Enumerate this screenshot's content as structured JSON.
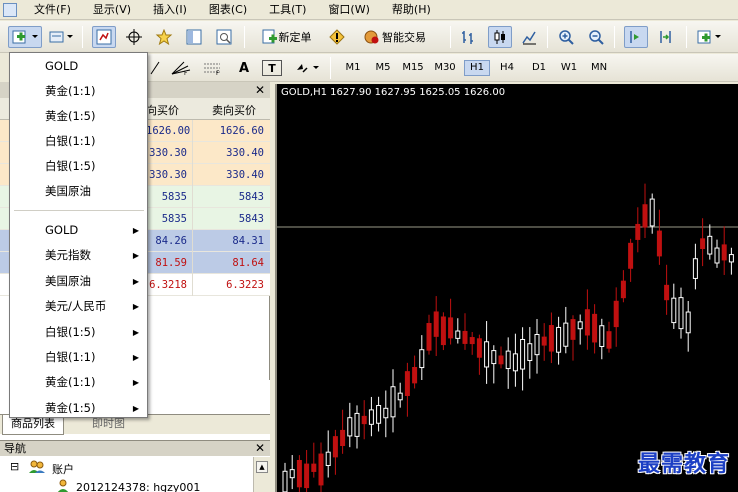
{
  "menu": [
    "文件(F)",
    "显示(V)",
    "插入(I)",
    "图表(C)",
    "工具(T)",
    "窗口(W)",
    "帮助(H)"
  ],
  "toolbar": {
    "new_order_label": "新定单",
    "expert_label": "智能交易"
  },
  "timeframes": [
    "M1",
    "M5",
    "M15",
    "M30",
    "H1",
    "H4",
    "D1",
    "W1",
    "MN"
  ],
  "active_timeframe": "H1",
  "drawing_tools": {
    "text_tool": "A",
    "text_label_tool": "T"
  },
  "market_watch": {
    "column_bid": "向买价",
    "column_ask": "卖向买价",
    "rows": [
      {
        "bid": "1626.00",
        "ask": "1626.60",
        "bg": "#fce8c8",
        "color": "#1a2a8a"
      },
      {
        "bid": "330.30",
        "ask": "330.40",
        "bg": "#fce8c8",
        "color": "#1a2a8a"
      },
      {
        "bid": "330.30",
        "ask": "330.40",
        "bg": "#fce8c8",
        "color": "#1a2a8a"
      },
      {
        "bid": "5835",
        "ask": "5843",
        "bg": "#e8f5e4",
        "color": "#1a2a8a"
      },
      {
        "bid": "5835",
        "ask": "5843",
        "bg": "#e8f5e4",
        "color": "#1a2a8a"
      },
      {
        "bid": "84.26",
        "ask": "84.31",
        "bg": "#bccbe6",
        "color": "#1a2a8a"
      },
      {
        "bid": "81.59",
        "ask": "81.64",
        "bg": "#bccbe6",
        "color": "#c01010"
      },
      {
        "bid": "6.3218",
        "ask": "6.3223",
        "bg": "#ffffff",
        "color": "#c01010"
      }
    ]
  },
  "tabs": [
    "商品列表",
    "即时图"
  ],
  "dropdown": {
    "items_top": [
      "GOLD",
      "黄金(1:1)",
      "黄金(1:5)",
      "白银(1:1)",
      "白银(1:5)",
      "美国原油"
    ],
    "items_sub": [
      "GOLD",
      "美元指数",
      "美国原油",
      "美元/人民币",
      "白银(1:5)",
      "白银(1:1)",
      "黄金(1:1)",
      "黄金(1:5)"
    ]
  },
  "navigator": {
    "title": "导航",
    "account_label": "账户",
    "account_entry": "2012124378: hgzy001"
  },
  "chart": {
    "info": "GOLD,H1  1627.90 1627.95 1625.05 1626.00",
    "bull_color": "#ffffff",
    "bear_color": "#c01010",
    "price_line_color": "#9a9a88"
  },
  "watermark": "最需教育"
}
